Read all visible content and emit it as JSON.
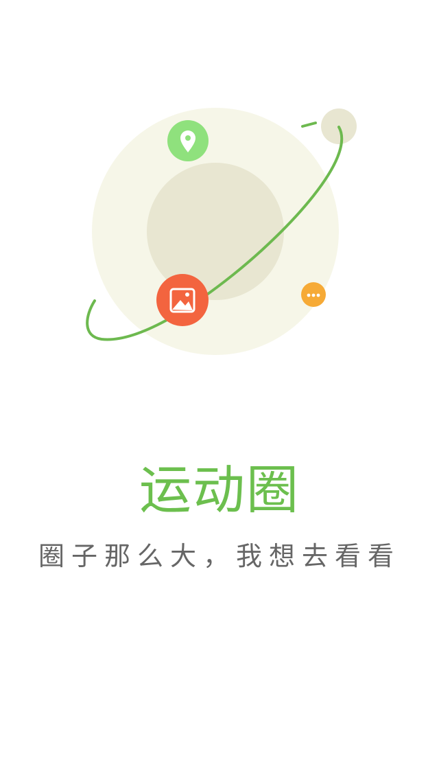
{
  "app": {
    "title": "运动圈",
    "subtitle": "圈子那么大，我想去看看"
  },
  "illustration": {
    "icons": [
      {
        "name": "location-pin-icon",
        "color": "#8fe17d"
      },
      {
        "name": "image-icon",
        "color": "#f3643f"
      },
      {
        "name": "more-dots-icon",
        "color": "#f6aa36"
      }
    ]
  },
  "colors": {
    "accent": "#6cbf4e",
    "subtitle_text": "#666666",
    "orbit": "#6db94f",
    "planet_outer": "#f6f6e8",
    "planet_inner": "#e8e6d1",
    "moon": "#e8e6d1"
  }
}
